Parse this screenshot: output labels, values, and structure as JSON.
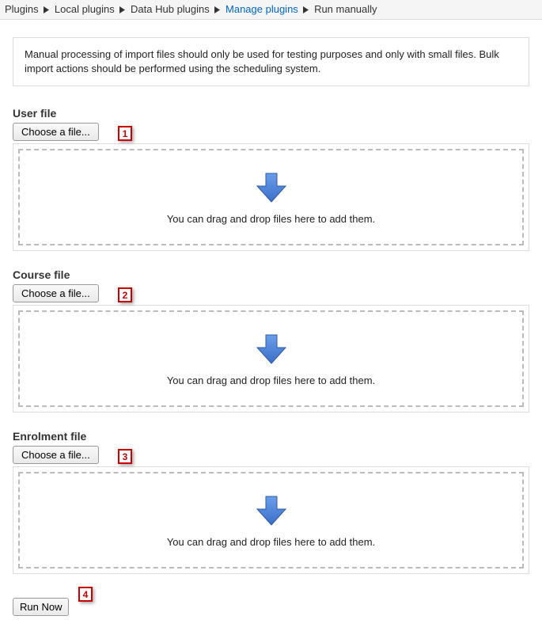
{
  "breadcrumb": {
    "items": [
      {
        "label": "Plugins",
        "type": "text"
      },
      {
        "label": "Local plugins",
        "type": "text"
      },
      {
        "label": "Data Hub plugins",
        "type": "text"
      },
      {
        "label": "Manage plugins",
        "type": "link"
      },
      {
        "label": "Run manually",
        "type": "text"
      }
    ]
  },
  "info_text": "Manual processing of import files should only be used for testing purposes and only with small files. Bulk import actions should be performed using the scheduling system.",
  "sections": {
    "user": {
      "title": "User file",
      "button_label": "Choose a file...",
      "drop_text": "You can drag and drop files here to add them.",
      "callout": "1"
    },
    "course": {
      "title": "Course file",
      "button_label": "Choose a file...",
      "drop_text": "You can drag and drop files here to add them.",
      "callout": "2"
    },
    "enrolment": {
      "title": "Enrolment file",
      "button_label": "Choose a file...",
      "drop_text": "You can drag and drop files here to add them.",
      "callout": "3"
    }
  },
  "run": {
    "label": "Run Now",
    "callout": "4"
  }
}
